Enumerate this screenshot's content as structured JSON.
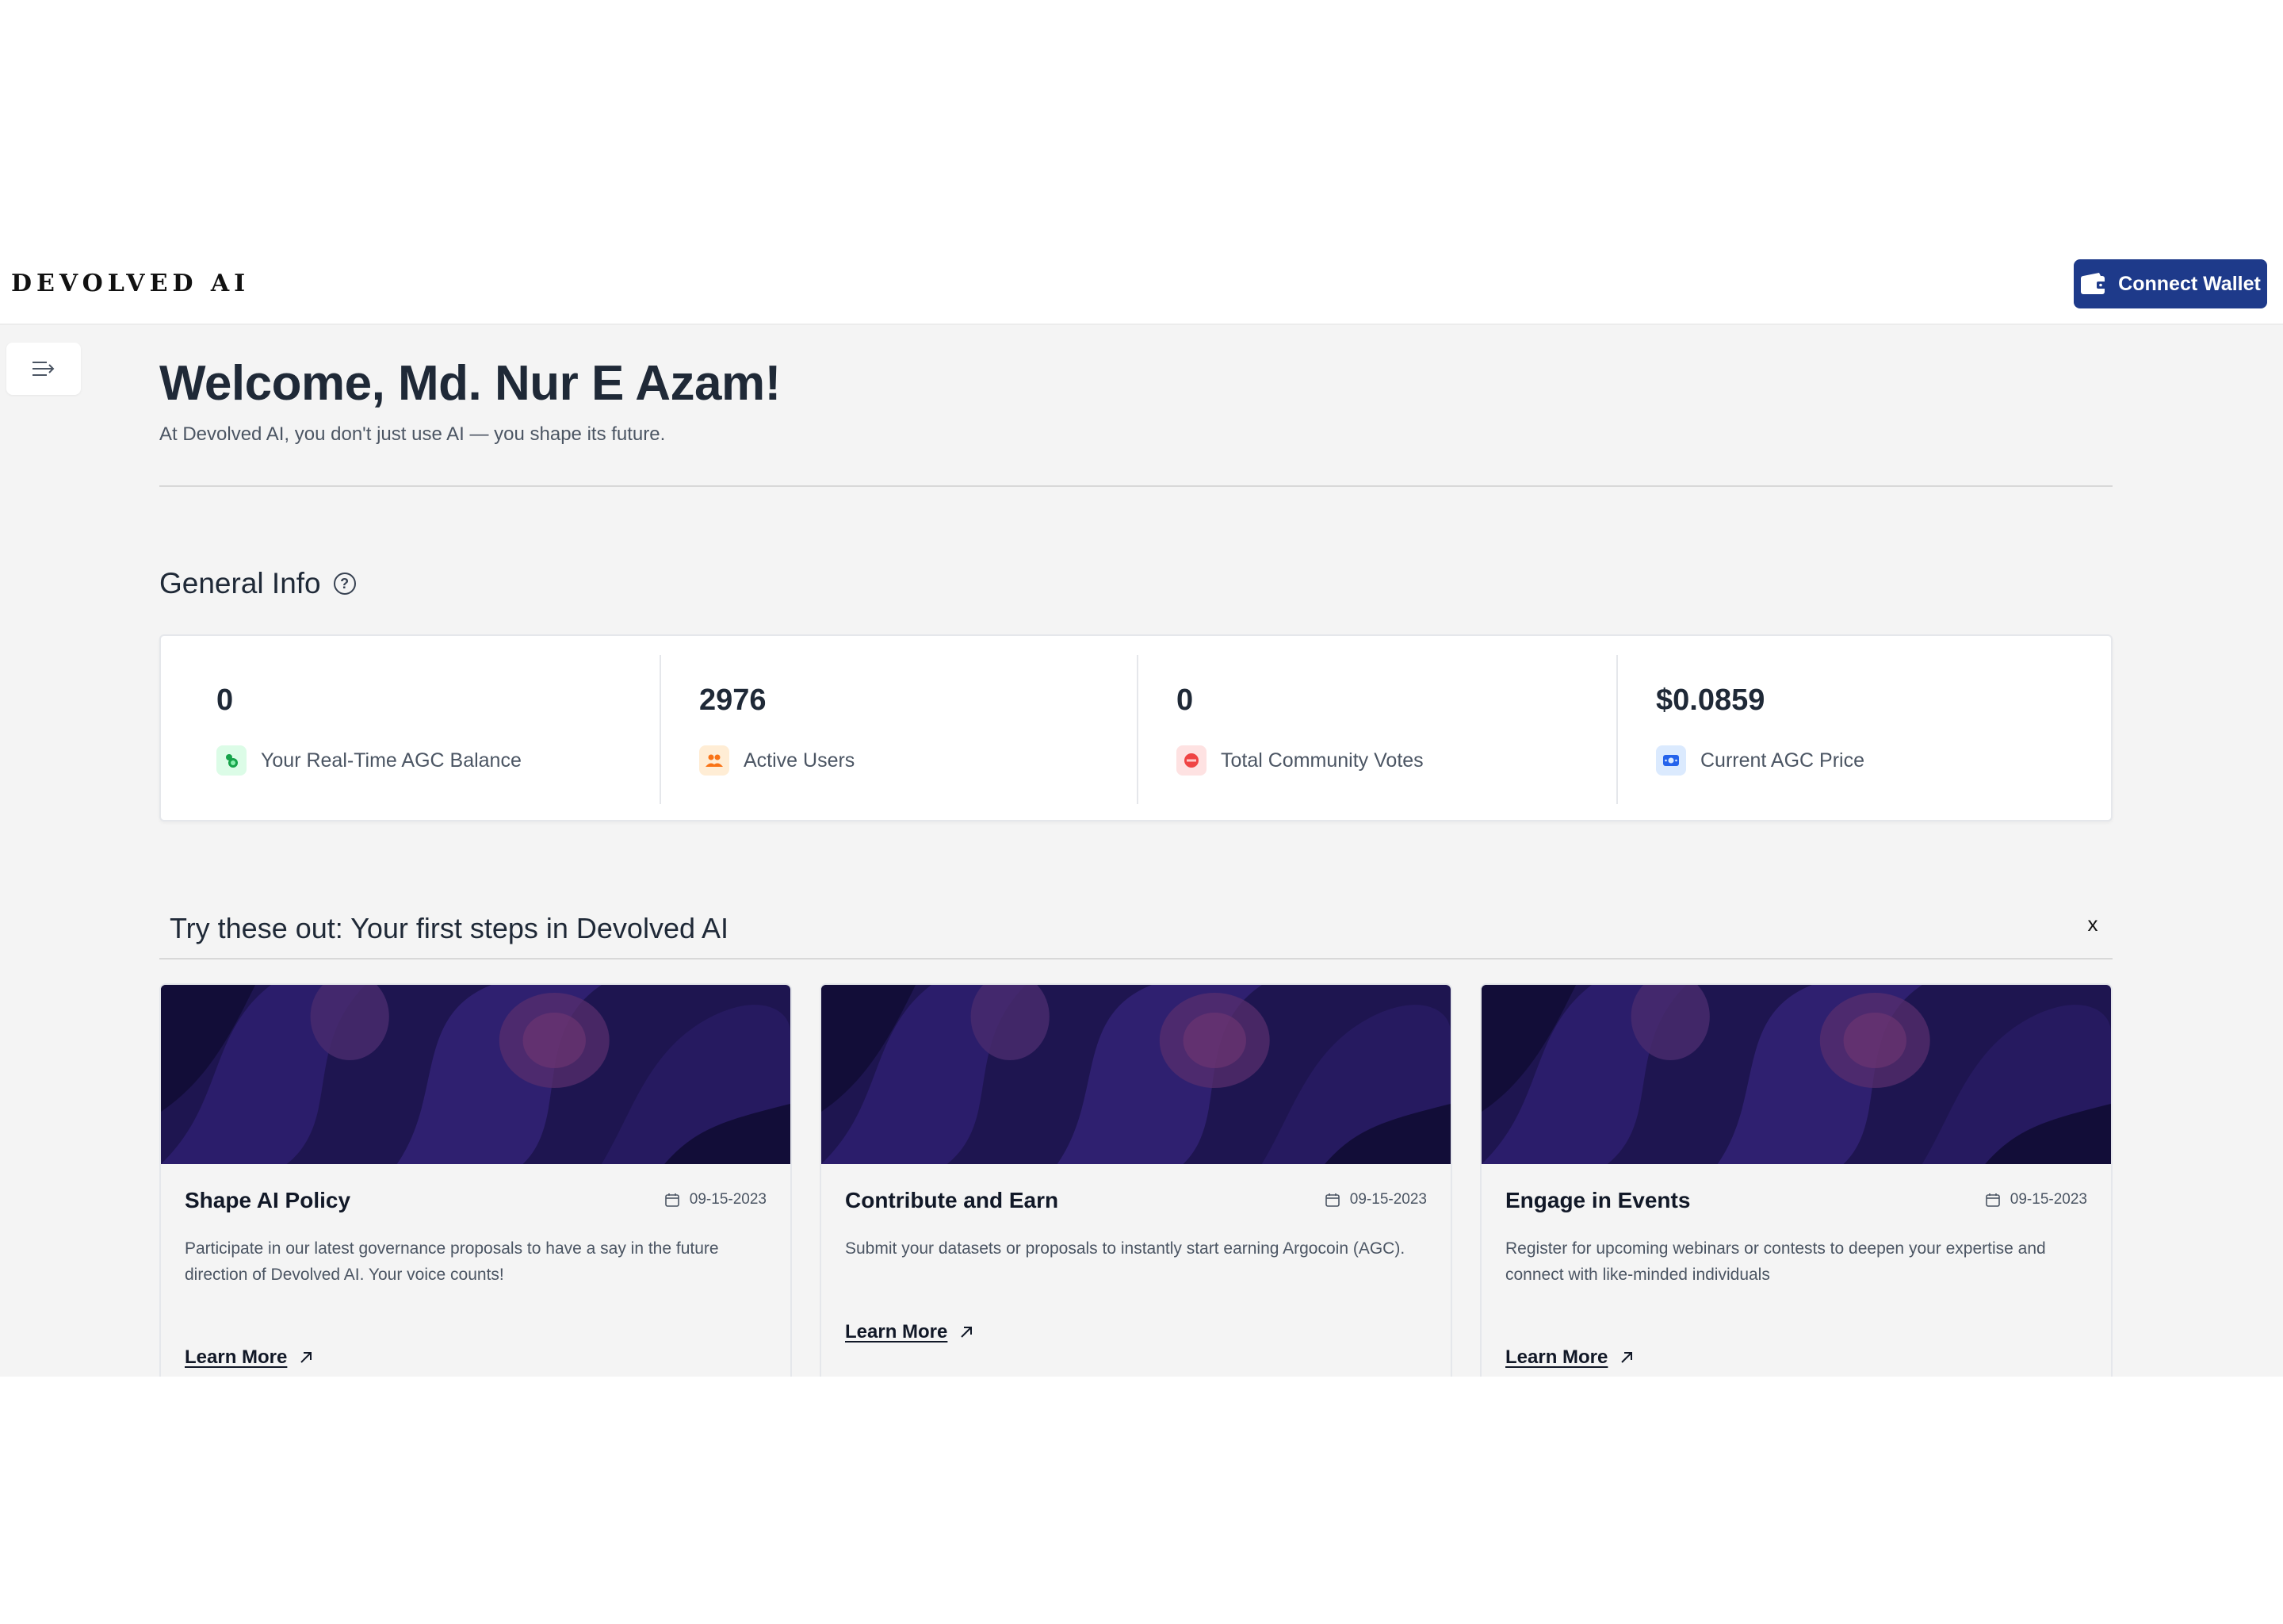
{
  "header": {
    "logo_text": "DEVOLVED AI",
    "connect_wallet_label": "Connect Wallet",
    "connect_wallet_icon": "wallet-icon"
  },
  "sidebar": {
    "toggle_icon": "sidebar-expand-icon"
  },
  "main": {
    "welcome_title": "Welcome, Md. Nur E Azam!",
    "subtitle": "At Devolved AI, you don't just use AI — you shape its future.",
    "general_info": {
      "title": "General Info",
      "help_icon": "help-circle-icon",
      "stats": [
        {
          "value": "0",
          "label": "Your Real-Time AGC Balance",
          "icon": "coins-icon",
          "color": "#16a34a"
        },
        {
          "value": "2976",
          "label": "Active Users",
          "icon": "users-icon",
          "color": "#f97316"
        },
        {
          "value": "0",
          "label": "Total Community Votes",
          "icon": "vote-icon",
          "color": "#ef4444"
        },
        {
          "value": "$0.0859",
          "label": "Current AGC Price",
          "icon": "price-tag-icon",
          "color": "#2563eb"
        }
      ]
    },
    "first_steps": {
      "title": "Try these out: Your first steps in Devolved AI",
      "close_label": "x",
      "cards": [
        {
          "title": "Shape AI Policy",
          "date": "09-15-2023",
          "description": "Participate in our latest governance proposals to have a say in the future direction of Devolved AI. Your voice counts!",
          "link_label": "Learn More"
        },
        {
          "title": "Contribute and Earn",
          "date": "09-15-2023",
          "description": "Submit your datasets or proposals to instantly start earning Argocoin (AGC).",
          "link_label": "Learn More"
        },
        {
          "title": "Engage in Events",
          "date": "09-15-2023",
          "description": "Register for upcoming webinars or contests to deepen your expertise and connect with like-minded individuals",
          "link_label": "Learn More"
        }
      ]
    }
  }
}
